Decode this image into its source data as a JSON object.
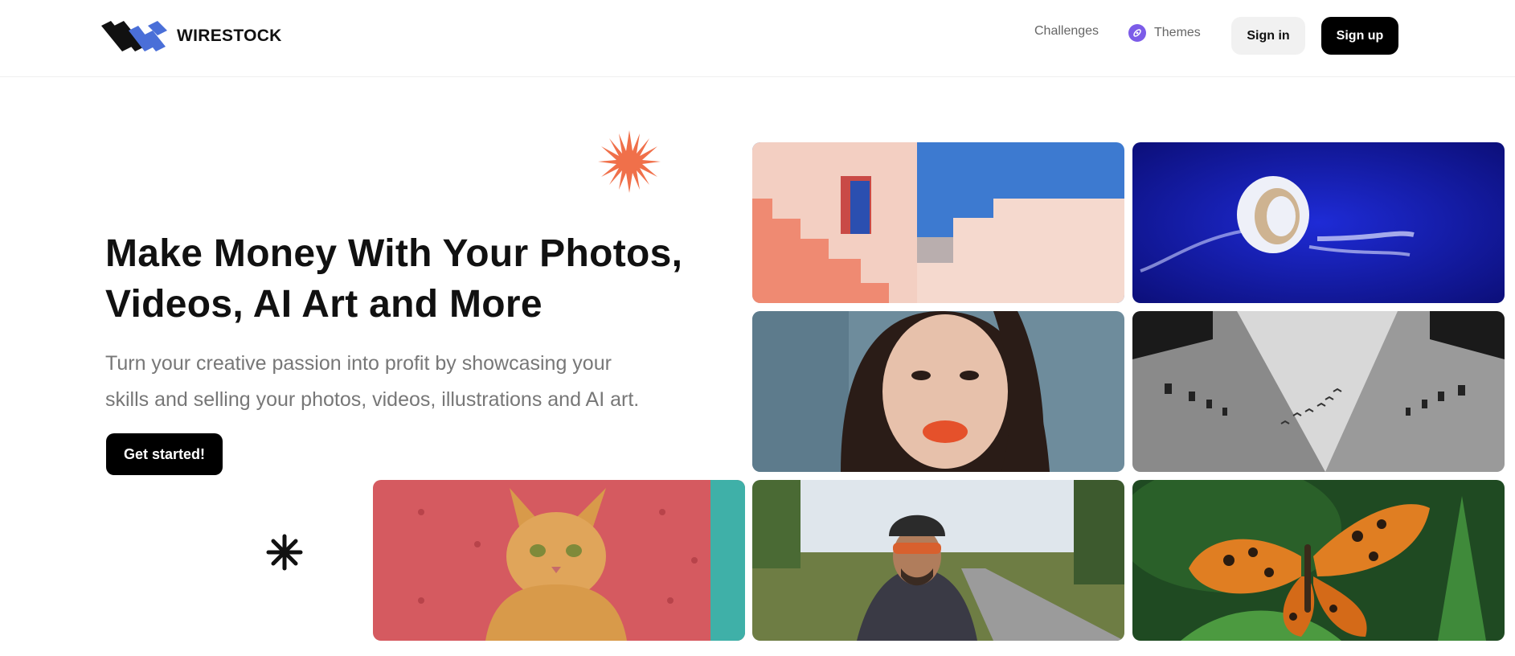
{
  "header": {
    "brand": "WIRESTOCK",
    "nav": {
      "challenges": "Challenges",
      "themes": "Themes"
    },
    "sign_in": "Sign in",
    "sign_up": "Sign up"
  },
  "hero": {
    "title_line1": "Make Money With Your Photos,",
    "title_line2": "Videos, AI Art and More",
    "subtitle_line1": "Turn your creative passion into profit by showcasing your",
    "subtitle_line2": "skills and selling your photos, videos, illustrations and AI art.",
    "cta": "Get started!"
  },
  "colors": {
    "accent_orange": "#f0704a",
    "themes_purple": "#7c5ce8",
    "logo_blue": "#4a6fd8"
  },
  "gallery": {
    "tiles": [
      {
        "name": "gallery-tile-pink-stairs",
        "subject": "pink-stairs-architecture"
      },
      {
        "name": "gallery-tile-jellyfish",
        "subject": "jellyfish"
      },
      {
        "name": "gallery-tile-portrait",
        "subject": "portrait"
      },
      {
        "name": "gallery-tile-buildings",
        "subject": "buildings-birds"
      },
      {
        "name": "gallery-tile-cat",
        "subject": "cat-on-sofa"
      },
      {
        "name": "gallery-tile-cyclist",
        "subject": "cyclist"
      },
      {
        "name": "gallery-tile-butterfly",
        "subject": "butterfly"
      }
    ]
  }
}
